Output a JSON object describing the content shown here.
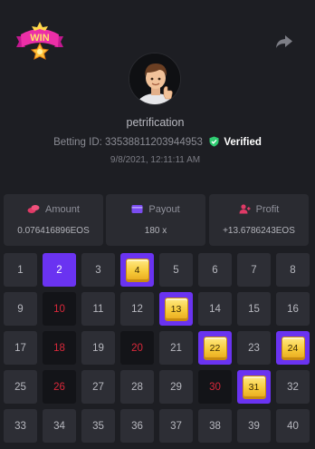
{
  "header": {
    "logo_text": "WIN",
    "username": "petrification",
    "betting_id_label": "Betting ID:",
    "betting_id": "33538811203944953",
    "verified_label": "Verified",
    "datetime": "9/8/2021, 12:11:11 AM"
  },
  "stats": {
    "amount": {
      "label": "Amount",
      "value": "0.076416896EOS"
    },
    "payout": {
      "label": "Payout",
      "value": "180 x"
    },
    "profit": {
      "label": "Profit",
      "value": "+13.6786243EOS"
    }
  },
  "colors": {
    "background": "#1d1e23",
    "cell": "#2d2e35",
    "drawn_cell": "#131418",
    "drawn_text": "#d9283a",
    "selected": "#6a33f1",
    "gem": "#f7cb3a",
    "verified": "#2ecc71"
  },
  "grid": {
    "numbers": [
      "1",
      "2",
      "3",
      "4",
      "5",
      "6",
      "7",
      "8",
      "9",
      "10",
      "11",
      "12",
      "13",
      "14",
      "15",
      "16",
      "17",
      "18",
      "19",
      "20",
      "21",
      "22",
      "23",
      "24",
      "25",
      "26",
      "27",
      "28",
      "29",
      "30",
      "31",
      "32",
      "33",
      "34",
      "35",
      "36",
      "37",
      "38",
      "39",
      "40"
    ],
    "selected_only": [
      2
    ],
    "hits": [
      4,
      13,
      22,
      24,
      31
    ],
    "drawn": [
      10,
      18,
      20,
      26,
      30
    ]
  },
  "icons": {
    "share": "share-arrow-icon",
    "verified": "shield-check-icon",
    "amount": "coins-icon",
    "payout": "wallet-icon",
    "profit": "user-gain-icon"
  }
}
